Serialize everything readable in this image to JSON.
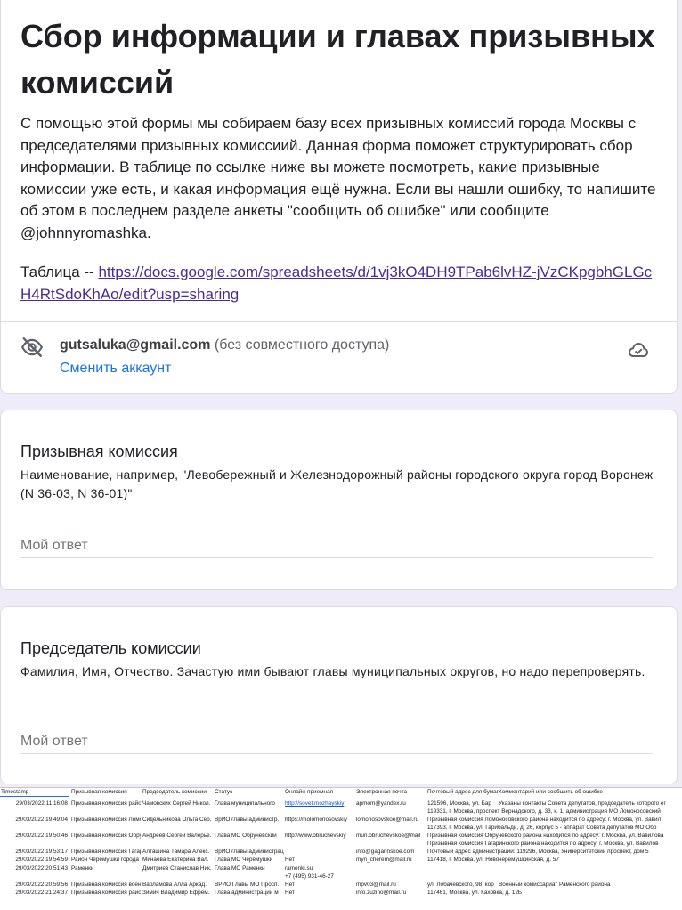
{
  "form": {
    "title": "Сбор информации и главах призывных комиссий",
    "description": [
      "С помощью этой формы мы собираем базу всех призывных комиссий города Москвы с председателями призывных комиссиий. Данная форма поможет структурировать сбор информации. В таблице по ссылке ниже вы можете посмотреть, какие призывные комиссии уже есть, и какая информация ещё нужна. Если вы нашли ошибку, то напишите об этом в последнем разделе анкеты \"сообщить об ошибке\" или сообщите @johnnyromashka."
    ],
    "table_prefix": "Таблица -- ",
    "table_link": "https://docs.google.com/spreadsheets/d/1vj3kO4DH9TPab6lvHZ-jVzCKpgbhGLGcH4RtSdoKhAo/edit?usp=sharing"
  },
  "account": {
    "email": "gutsaluka@gmail.com",
    "note": "(без совместного доступа)",
    "switch_label": "Сменить аккаунт",
    "icons": [
      "no-see-icon",
      "cloud-check-icon"
    ]
  },
  "questions": [
    {
      "title": "Призывная комиссия",
      "description": "Наименование, например, \"Левобережный и Железнодорожный районы городского округа город Воронеж (N 36-03, N 36-01)\"",
      "placeholder": "Мой ответ"
    },
    {
      "title": "Председатель комиссии",
      "description": "Фамилия, Имя, Отчество. Зачастую ими бывают главы муниципальных округов, но надо перепроверять.",
      "placeholder": "Мой ответ"
    }
  ],
  "sheet": {
    "headers": [
      "Timestamp",
      "Призывная комиссия",
      "Председатель комиссии",
      "Статус",
      "Онлайн-приемная",
      "Электронная почта",
      "Почтовый адрес для бумаг",
      "Комментарий или сообщить об ошибке"
    ],
    "rows": [
      {
        "timestamp": "29/03/2022 11:16:08",
        "commission": "Призывная комиссия района Можайский",
        "chairman": "Чамовских Сергей Никол.",
        "status": "Глава муниципального",
        "online": "http://sovet.mozhayskiy",
        "email": "apmom@yandex.ru",
        "address": "121596, Москва, ул. Бар",
        "comment": "Указаны контакты Совета депутатов, председатель которого ег"
      },
      {
        "timestamp": "",
        "commission": "",
        "chairman": "",
        "status": "",
        "online": "",
        "email": "",
        "address": "119331, г. Москва, проспект Вернадского, д. 33, к. 1, администрация МО Ломоносовский",
        "comment": ""
      },
      {
        "timestamp": "29/03/2022 19:49:04",
        "commission": "Призывная комиссия Ломоносовского",
        "chairman": "Сидельникова Ольга Сер.",
        "status": "ВрИО главы администр.",
        "online": "https://molomonosovskiy",
        "email": "lomonosovskoe@mail.ru",
        "address": "Призывная комиссия Ломоносовского района находится по адресу: г. Москва, ул. Вавил",
        "comment": ""
      },
      {
        "timestamp": "",
        "commission": "",
        "chairman": "",
        "status": "",
        "online": "",
        "email": "",
        "address": "117393, г. Москва, ул. Гарибальди, д. 26, корпус 5 - аппарат Совета депутатов МО Обр",
        "comment": ""
      },
      {
        "timestamp": "29/03/2022 19:50:46",
        "commission": "Призывная комиссия Обручевского",
        "chairman": "Андреев Сергей Валерье.",
        "status": "Глава МО Обручевский",
        "online": "http://www.obruchevskiy",
        "email": "mun.obruchevskoe@mail",
        "address": "Призывная комиссия Обручевского района находится по адресу: г. Москва, ул. Вавилова",
        "comment": ""
      },
      {
        "timestamp": "",
        "commission": "",
        "chairman": "",
        "status": "",
        "online": "",
        "email": "",
        "address": "Призывная комиссия Гагаринского района находится по адресу: г. Москва, ул. Вавилов",
        "comment": ""
      },
      {
        "timestamp": "29/03/2022 19:53:17",
        "commission": "Призывная комиссия Гагаринского",
        "chairman": "Алташина Тамара Алекс.",
        "status": "ВрИО главы администрации МО Гагаринский",
        "online": "",
        "email": "info@gagarinskoe.com",
        "address": "Почтовый адрес администрации: 119296, Москва, Университетский проспект, дом 5",
        "comment": ""
      },
      {
        "timestamp": "29/03/2022 19:54:59",
        "commission": "Район Черёмушки города Москвы",
        "chairman": "Минаева Екатерина Вал.",
        "status": "Глава МО Черёмушки",
        "online": "Нет",
        "email": "myn_cherem@mail.ru",
        "address": "117418, г. Москва, ул. Новочеремушкинская, д. 57",
        "comment": ""
      },
      {
        "timestamp": "29/03/2022 20:51:43",
        "commission": "Раменки",
        "chairman": "Дмитриев Станислав Ник.",
        "status": "Глава МО Раменки",
        "online": "ramenki.su",
        "email": "",
        "address": "",
        "comment": ""
      },
      {
        "timestamp": "",
        "commission": "",
        "chairman": "",
        "status": "",
        "online": "+7 (495) 931-46-27",
        "email": "",
        "address": "",
        "comment": ""
      },
      {
        "timestamp": "29/03/2022 20:59:56",
        "commission": "Призывная комиссия военного",
        "chairman": "Варламова Алла Аркад.",
        "status": "ВРИО Главы МО Просп.",
        "online": "Нет",
        "email": "mpv03@mail.ru",
        "address": "ул. Лобачевского, 98, кор",
        "comment": "Военный комиссариат Раменского района"
      },
      {
        "timestamp": "29/03/2022 21:24:37",
        "commission": "Призывная комиссия района",
        "chairman": "Зимич Владимир Ефрем.",
        "status": "Глава администрации м",
        "online": "Нет",
        "email": "info.zuzino@mail.ru",
        "address": "117461, Москва, ул. Каховка, д. 12Б",
        "comment": ""
      }
    ]
  }
}
